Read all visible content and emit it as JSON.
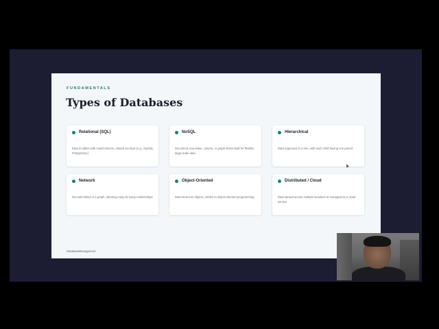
{
  "slide": {
    "eyebrow": "FUNDAMENTALS",
    "title": "Types of Databases",
    "footer": "DatabaseManagement",
    "accent_color": "#17806c",
    "cards": [
      {
        "title": "Relational (SQL)",
        "description": "Data in tables with rows/columns, related via keys (e.g., MySQL, PostgreSQL)"
      },
      {
        "title": "NoSQL",
        "description": "Document, key-value, column, or graph stores built for flexible, large-scale data"
      },
      {
        "title": "Hierarchical",
        "description": "Data organized in a tree, with each child having one parent"
      },
      {
        "title": "Network",
        "description": "Records linked in a graph, allowing many-to-many relationships"
      },
      {
        "title": "Object-Oriented",
        "description": "Data stored as objects, similar to object-oriented programming"
      },
      {
        "title": "Distributed / Cloud",
        "description": "Data spread across multiple locations or managed as a cloud service"
      }
    ]
  },
  "overlay": {
    "webcam": "presenter-webcam-feed",
    "cursor": "mouse-pointer-icon"
  }
}
